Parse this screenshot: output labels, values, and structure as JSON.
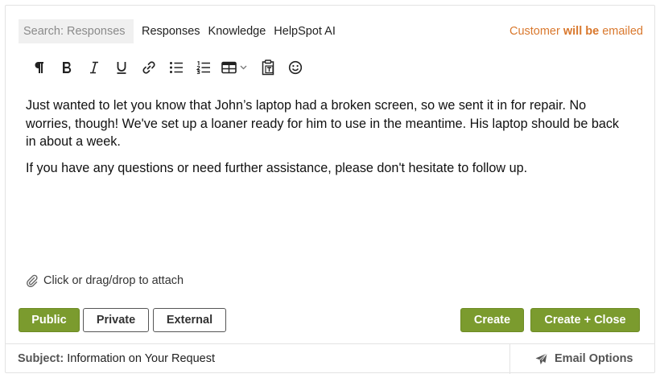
{
  "header": {
    "search_placeholder": "Search: Responses",
    "links": [
      "Responses",
      "Knowledge",
      "HelpSpot AI"
    ],
    "notice_prefix": "Customer ",
    "notice_bold": "will be",
    "notice_suffix": " emailed",
    "notice_color": "#d9782d"
  },
  "toolbar": {
    "icons": [
      "paragraph-icon",
      "bold-icon",
      "italic-icon",
      "underline-icon",
      "link-icon",
      "bullet-list-icon",
      "numbered-list-icon",
      "table-icon",
      "paste-text-icon",
      "emoji-icon"
    ]
  },
  "editor": {
    "paragraphs": [
      "Just wanted to let you know that John’s laptop had a broken screen, so we sent it in for repair. No worries, though! We've set up a loaner ready for him to use in the meantime. His laptop should be back in about a week.",
      "If you have any questions or need further assistance, please don't hesitate to follow up."
    ]
  },
  "attach": {
    "label": "Click or drag/drop to attach"
  },
  "actions": {
    "public": "Public",
    "private": "Private",
    "external": "External",
    "create": "Create",
    "create_close": "Create + Close",
    "accent": "#7b9b2e"
  },
  "footer": {
    "subject_label": "Subject:",
    "subject_value": " Information on Your Request",
    "email_options": "Email Options"
  }
}
